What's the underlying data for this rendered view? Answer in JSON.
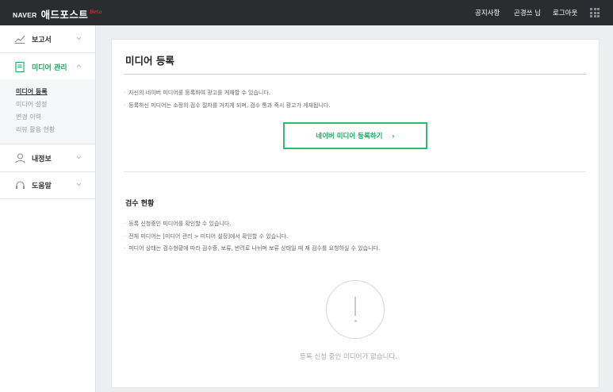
{
  "header": {
    "brand": "NAVER",
    "app_name": "애드포스트",
    "beta": "Beta",
    "nav": [
      "공지사항",
      "곤경쓰 님",
      "로그아웃"
    ],
    "apps_icon": "grid-icon"
  },
  "sidebar": {
    "menus": [
      {
        "label": "보고서",
        "icon": "chart-icon",
        "expanded": false
      },
      {
        "label": "미디어 관리",
        "icon": "document-icon",
        "expanded": true
      },
      {
        "label": "내정보",
        "icon": "person-icon",
        "expanded": false
      },
      {
        "label": "도움말",
        "icon": "headset-icon",
        "expanded": false
      }
    ],
    "submenu": [
      "미디어 등록",
      "미디어 설정",
      "변경 이력",
      "리뷰 활용 현황"
    ],
    "accent_color": "#21a65c"
  },
  "main": {
    "title": "미디어 등록",
    "notes": [
      "자신의 네이버 미디어를 등록하여 광고를 게재할 수 있습니다.",
      "등록하신 미디어는 소정의 검수 절차를 거치게 되며, 검수 통과 즉시 광고가 게재됩니다."
    ],
    "register_button": "네이버 미디어 등록하기",
    "register_arrow": "›",
    "review": {
      "title": "검수 현황",
      "notes": [
        "등록 신청중인 미디어를 확인할 수 있습니다.",
        "전체 미디어는 [미디어 관리 > 미디어 설정]에서 확인할 수 있습니다.",
        "미디어 상태는 검수현황에 따라 검수중, 보류, 반려로 나뉘며 보류 상태일 때 재 검수를 요청하실 수 있습니다."
      ],
      "empty_icon": "exclamation-icon",
      "empty_message": "등록 신청 중인 미디어가 없습니다."
    }
  }
}
